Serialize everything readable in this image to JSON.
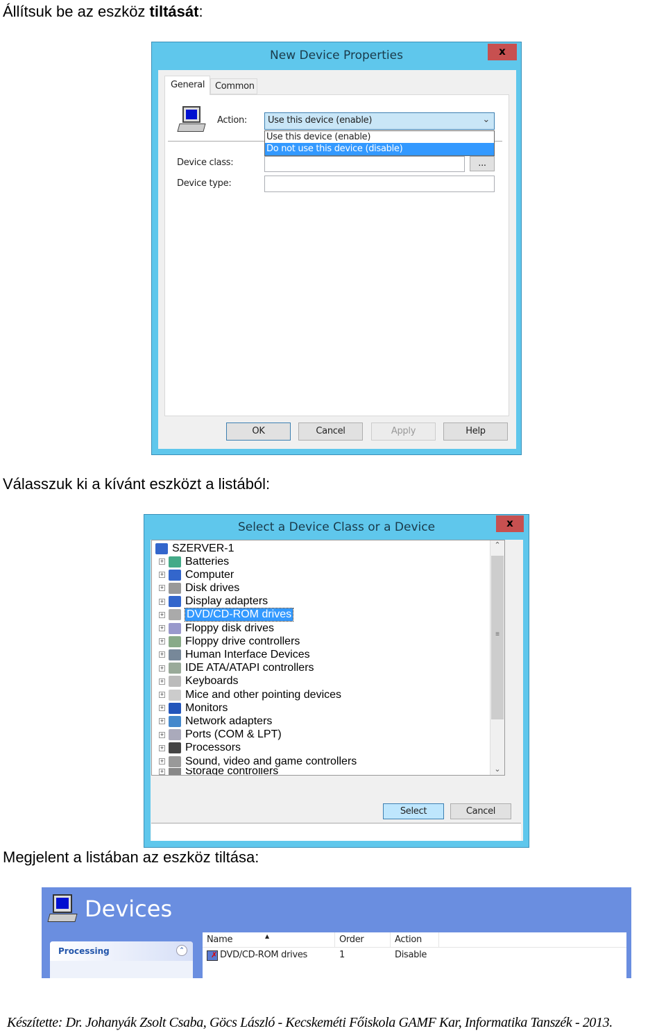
{
  "headings": {
    "h1_prefix": "Állítsuk be az eszköz ",
    "h1_bold": "tiltását",
    "h1_suffix": ":",
    "h2": "Válasszuk ki a kívánt eszközt a listából:",
    "h3": "Megjelent a listában az eszköz tiltása:"
  },
  "dialog1": {
    "title": "New Device Properties",
    "close": "x",
    "tabs": [
      "General",
      "Common"
    ],
    "action_label": "Action:",
    "action_value": "Use this device (enable)",
    "options": [
      "Use this device (enable)",
      "Do not use this device (disable)"
    ],
    "selected_option": 1,
    "device_class_label": "Device class:",
    "device_class_value": "",
    "browse": "...",
    "device_type_label": "Device type:",
    "device_type_value": "",
    "buttons": {
      "ok": "OK",
      "cancel": "Cancel",
      "apply": "Apply",
      "help": "Help"
    }
  },
  "dialog2": {
    "title": "Select a Device Class or a Device",
    "close": "x",
    "root": "SZERVER-1",
    "items": [
      "Batteries",
      "Computer",
      "Disk drives",
      "Display adapters",
      "DVD/CD-ROM drives",
      "Floppy disk drives",
      "Floppy drive controllers",
      "Human Interface Devices",
      "IDE ATA/ATAPI controllers",
      "Keyboards",
      "Mice and other pointing devices",
      "Monitors",
      "Network adapters",
      "Ports (COM & LPT)",
      "Processors",
      "Sound, video and game controllers",
      "Storage controllers"
    ],
    "selected": "DVD/CD-ROM drives",
    "buttons": {
      "select": "Select",
      "cancel": "Cancel"
    }
  },
  "devices": {
    "title": "Devices",
    "side_panel": "Processing",
    "columns": [
      "Name",
      "Order",
      "Action"
    ],
    "rows": [
      {
        "name": "DVD/CD-ROM drives",
        "order": "1",
        "action": "Disable"
      }
    ]
  },
  "footer": "Készítette: Dr. Johanyák Zsolt Csaba, Göcs László - Kecskeméti Főiskola GAMF Kar, Informatika Tanszék - 2013.",
  "colors": {
    "title_bar": "#5fc7ec",
    "close": "#c75050",
    "selection": "#3399ff",
    "devices_header": "#6a8ee0"
  }
}
